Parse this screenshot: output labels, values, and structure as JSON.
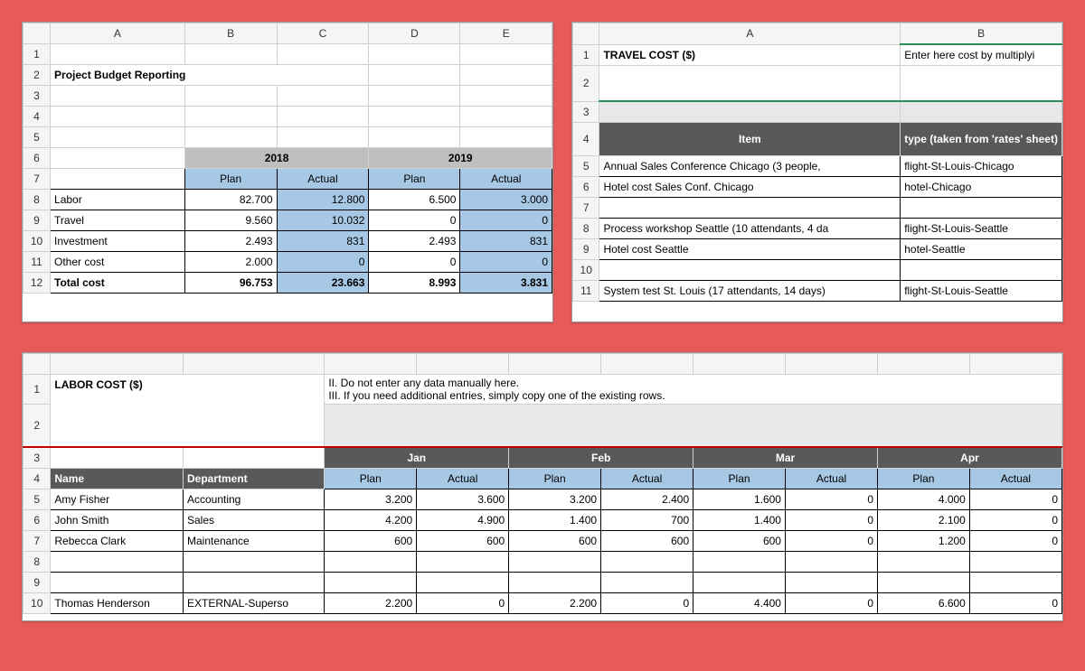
{
  "budget": {
    "colHeads": [
      "A",
      "B",
      "C",
      "D",
      "E"
    ],
    "title": "Project Budget Reporting",
    "years": [
      "2018",
      "2019"
    ],
    "subheads": [
      "Plan",
      "Actual",
      "Plan",
      "Actual"
    ],
    "rows": [
      {
        "label": "Labor",
        "vals": [
          "82.700",
          "12.800",
          "6.500",
          "3.000"
        ]
      },
      {
        "label": "Travel",
        "vals": [
          "9.560",
          "10.032",
          "0",
          "0"
        ]
      },
      {
        "label": "Investment",
        "vals": [
          "2.493",
          "831",
          "2.493",
          "831"
        ]
      },
      {
        "label": "Other cost",
        "vals": [
          "2.000",
          "0",
          "0",
          "0"
        ]
      },
      {
        "label": "Total cost",
        "vals": [
          "96.753",
          "23.663",
          "8.993",
          "3.831"
        ]
      }
    ]
  },
  "travel": {
    "colHeads": [
      "A",
      "B"
    ],
    "title": "TRAVEL COST ($)",
    "hint": "Enter here cost by multiplyi",
    "hdr": {
      "a": "Item",
      "b": "type (taken from 'rates' sheet)"
    },
    "rows": [
      [
        "Annual Sales Conference Chicago (3 people,",
        "flight-St-Louis-Chicago"
      ],
      [
        "Hotel cost Sales Conf. Chicago",
        "hotel-Chicago"
      ],
      [
        "",
        ""
      ],
      [
        "Process workshop Seattle (10 attendants, 4 da",
        "flight-St-Louis-Seattle"
      ],
      [
        "Hotel cost Seattle",
        "hotel-Seattle"
      ],
      [
        "",
        ""
      ],
      [
        "System test St. Louis (17 attendants, 14 days)",
        "flight-St-Louis-Seattle"
      ]
    ]
  },
  "labor": {
    "title": "LABOR COST ($)",
    "instr1": "II. Do not enter any data manually here.",
    "instr2": "III. If you need additional entries, simply copy one of the existing rows.",
    "months": [
      "Jan",
      "Feb",
      "Mar",
      "Apr"
    ],
    "subheads": [
      "Plan",
      "Actual"
    ],
    "nameHdr": "Name",
    "deptHdr": "Department",
    "rows": [
      {
        "name": "Amy Fisher",
        "dept": "Accounting",
        "vals": [
          "3.200",
          "3.600",
          "3.200",
          "2.400",
          "1.600",
          "0",
          "4.000",
          "0"
        ]
      },
      {
        "name": "John Smith",
        "dept": "Sales",
        "vals": [
          "4.200",
          "4.900",
          "1.400",
          "700",
          "1.400",
          "0",
          "2.100",
          "0"
        ]
      },
      {
        "name": "Rebecca Clark",
        "dept": "Maintenance",
        "vals": [
          "600",
          "600",
          "600",
          "600",
          "600",
          "0",
          "1.200",
          "0"
        ]
      }
    ],
    "extraRow": {
      "name": "Thomas Henderson",
      "dept": "EXTERNAL-Superso",
      "vals": [
        "2.200",
        "0",
        "2.200",
        "0",
        "4.400",
        "0",
        "6.600",
        "0"
      ]
    }
  }
}
